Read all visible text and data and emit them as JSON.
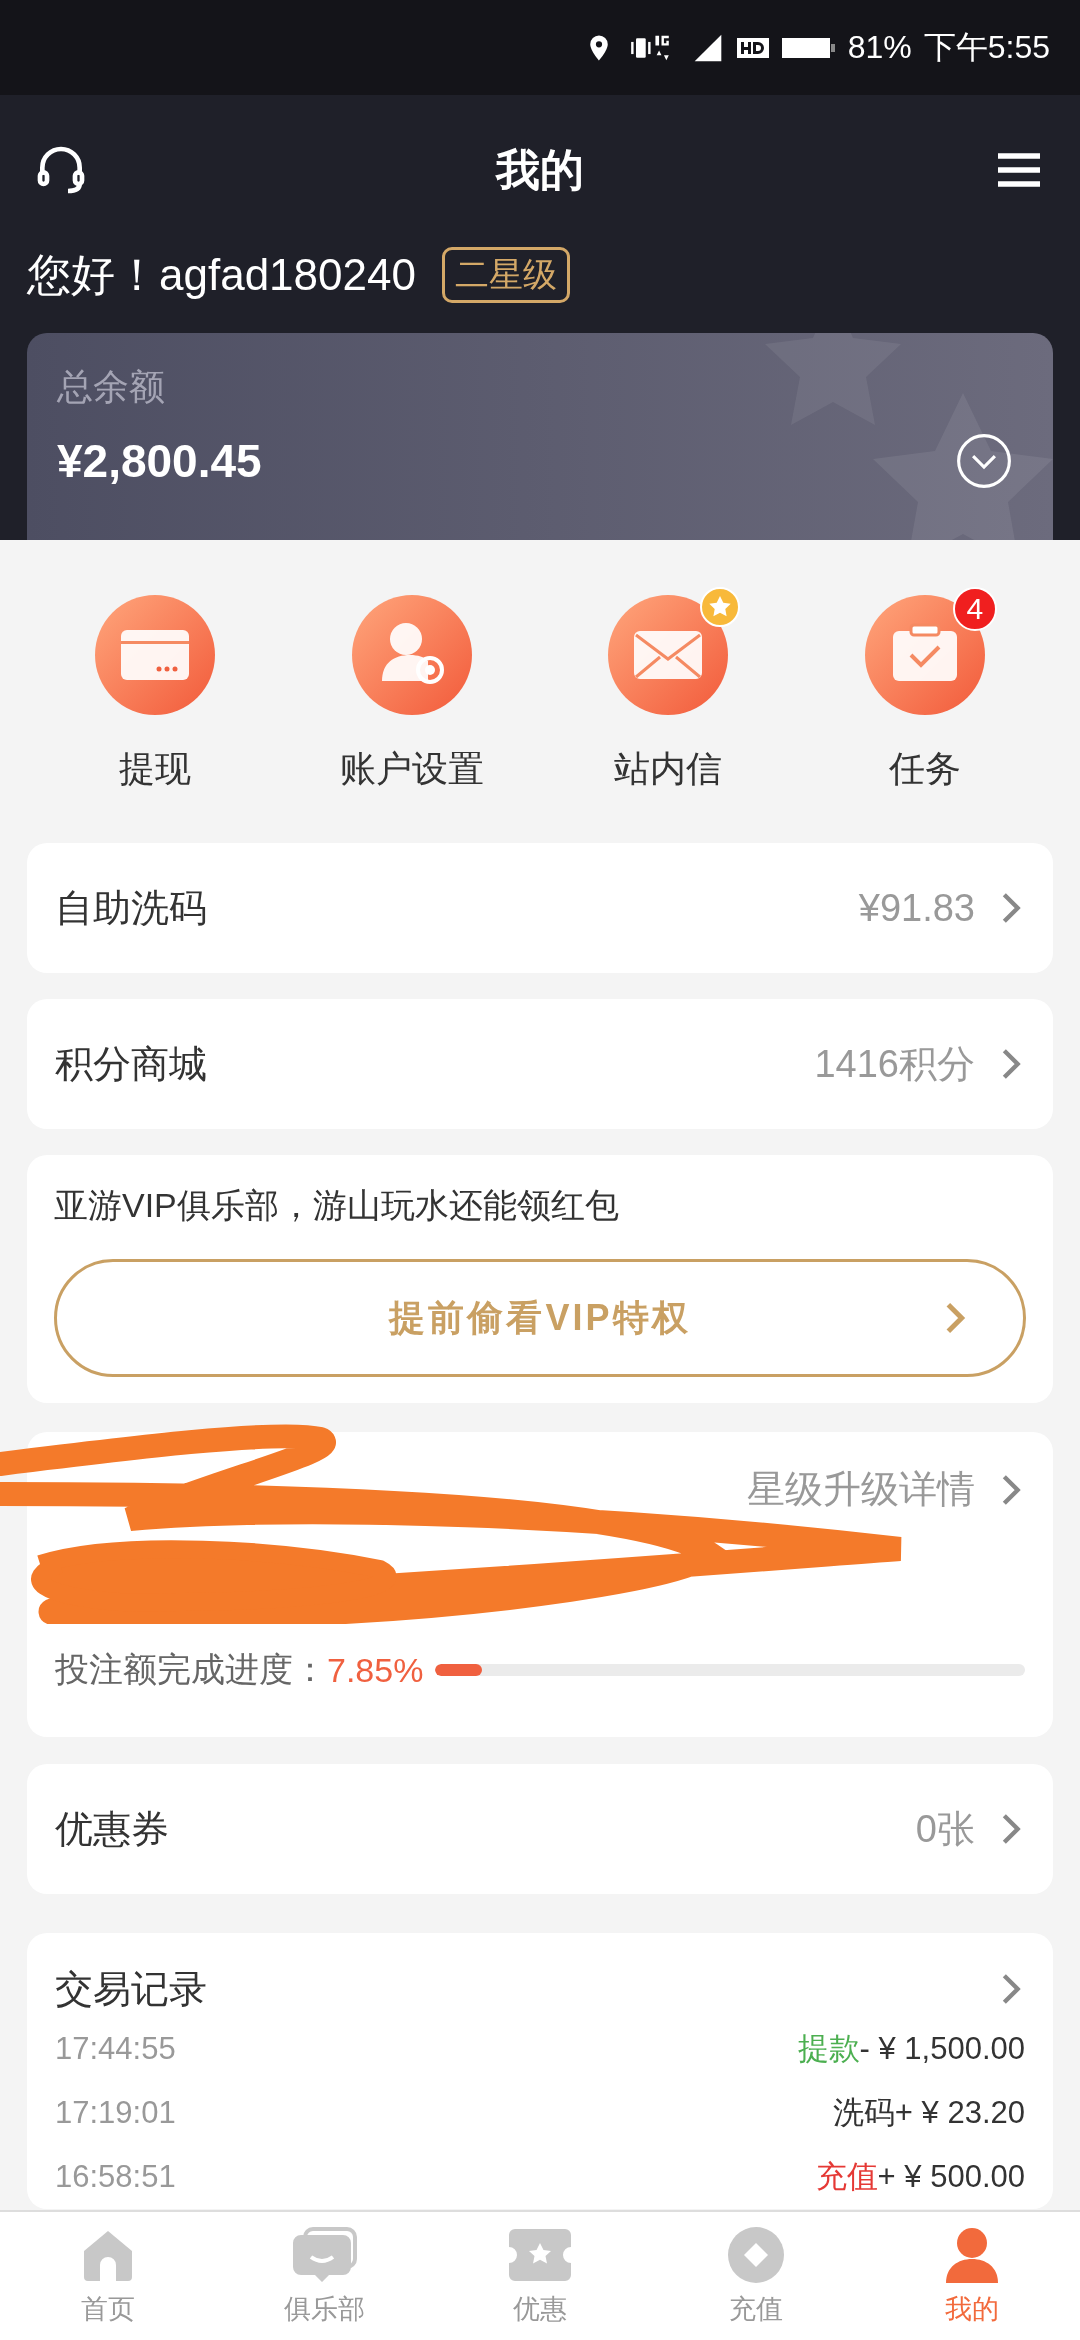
{
  "status_bar": {
    "battery": "81%",
    "time": "下午5:55"
  },
  "header": {
    "title": "我的",
    "greeting": "您好！agfad180240",
    "badge": "二星级"
  },
  "balance": {
    "label": "总余额",
    "amount": "¥2,800.45"
  },
  "shortcuts": [
    {
      "label": "提现",
      "kind": "card"
    },
    {
      "label": "账户设置",
      "kind": "user"
    },
    {
      "label": "站内信",
      "kind": "mail",
      "badge": {
        "kind": "star"
      }
    },
    {
      "label": "任务",
      "kind": "task",
      "badge": {
        "kind": "count",
        "text": "4"
      }
    }
  ],
  "menu_rows": [
    {
      "label": "自助洗码",
      "value": "¥91.83"
    },
    {
      "label": "积分商城",
      "value": "1416积分"
    }
  ],
  "vip_card": {
    "text": "亚游VIP俱乐部，游山玩水还能领红包",
    "button": "提前偷看VIP特权"
  },
  "level_card": {
    "link": "星级升级详情",
    "progress_label": "投注额完成进度：",
    "progress_value": "7.85%",
    "level": 0.0785
  },
  "coupon_row": {
    "label": "优惠券",
    "value": "0张"
  },
  "transactions": {
    "title": "交易记录",
    "rows": [
      {
        "time": "17:44:55",
        "type": "提款",
        "color": "#4caf50",
        "amount": "- ¥ 1,500.00"
      },
      {
        "time": "17:19:01",
        "type": "洗码",
        "color": "#333333",
        "amount": "+ ¥ 23.20"
      },
      {
        "time": "16:58:51",
        "type": "充值",
        "color": "#e53935",
        "amount": "+ ¥ 500.00"
      }
    ]
  },
  "tabs": [
    {
      "label": "首页",
      "kind": "home",
      "selected": false
    },
    {
      "label": "俱乐部",
      "kind": "chat",
      "selected": false
    },
    {
      "label": "优惠",
      "kind": "ticket",
      "selected": false
    },
    {
      "label": "充值",
      "kind": "coin",
      "selected": false
    },
    {
      "label": "我的",
      "kind": "user",
      "selected": true
    }
  ]
}
